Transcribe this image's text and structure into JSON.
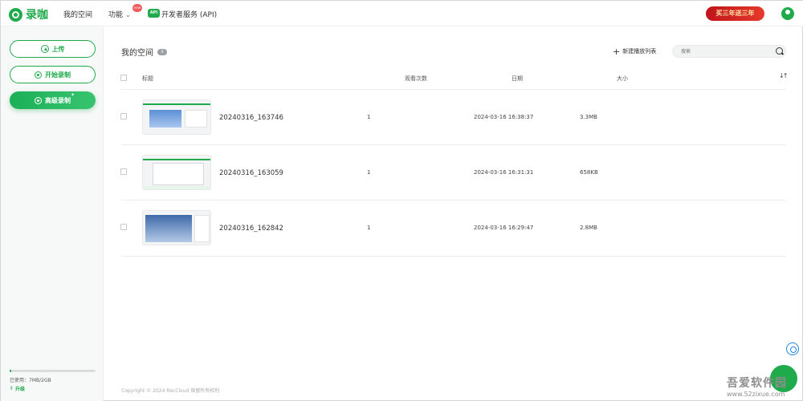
{
  "app": {
    "name": "录咖"
  },
  "nav": {
    "my_space": "我的空间",
    "features": "功能",
    "new_badge": "new",
    "api_badge": "API",
    "developer": "开发者服务 (API)"
  },
  "promo": {
    "text": "买三年送三年"
  },
  "sidebar": {
    "upload": "上传",
    "start_record": "开始录制",
    "hd_record": "高级录制",
    "storage_used": "已使用：7MB/2GB",
    "storage_fraction": 0.0035,
    "upgrade": "升级"
  },
  "main": {
    "title": "我的空间",
    "count": "3",
    "new_playlist": "新建播放列表",
    "search_placeholder": "搜索",
    "columns": {
      "title": "标题",
      "views": "观看次数",
      "date": "日期",
      "size": "大小"
    }
  },
  "rows": [
    {
      "name": "20240316_163746",
      "views": "1",
      "date": "2024-03-16 16:38:37",
      "size": "3.3MB"
    },
    {
      "name": "20240316_163059",
      "views": "1",
      "date": "2024-03-16 16:31:31",
      "size": "658KB"
    },
    {
      "name": "20240316_162842",
      "views": "1",
      "date": "2024-03-16 16:29:47",
      "size": "2.8MB"
    }
  ],
  "footer": {
    "copyright": "Copyright © 2024 RecCloud 保留所有权利"
  },
  "watermark": {
    "text": "吾爱软件园",
    "url": "www.52zixue.com"
  },
  "colors": {
    "accent": "#1faa4b",
    "promo": "#c0141c"
  }
}
